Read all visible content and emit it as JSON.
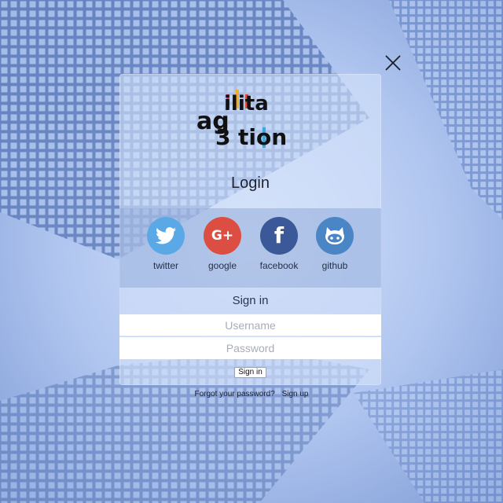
{
  "logo": {
    "top_letters": [
      "i",
      "l",
      "i",
      "t",
      "a"
    ],
    "bottom_text": "tion",
    "left_letters": [
      "a",
      "g",
      "3"
    ]
  },
  "login": {
    "title": "Login"
  },
  "social": [
    {
      "id": "twitter",
      "label": "twitter",
      "color": "#5aa9e6",
      "icon": "twitter-bird-icon"
    },
    {
      "id": "google",
      "label": "google",
      "color": "#dc4e41",
      "icon": "google-plus-icon",
      "glyph": "G+"
    },
    {
      "id": "facebook",
      "label": "facebook",
      "color": "#3b5998",
      "icon": "facebook-icon",
      "glyph": "f"
    },
    {
      "id": "github",
      "label": "github",
      "color": "#4a86c5",
      "icon": "github-octocat-icon"
    }
  ],
  "form": {
    "heading": "Sign in",
    "username_placeholder": "Username",
    "password_placeholder": "Password",
    "submit_label": "Sign in"
  },
  "links": {
    "forgot": "Forgot your password?",
    "signup": "Sign up"
  }
}
